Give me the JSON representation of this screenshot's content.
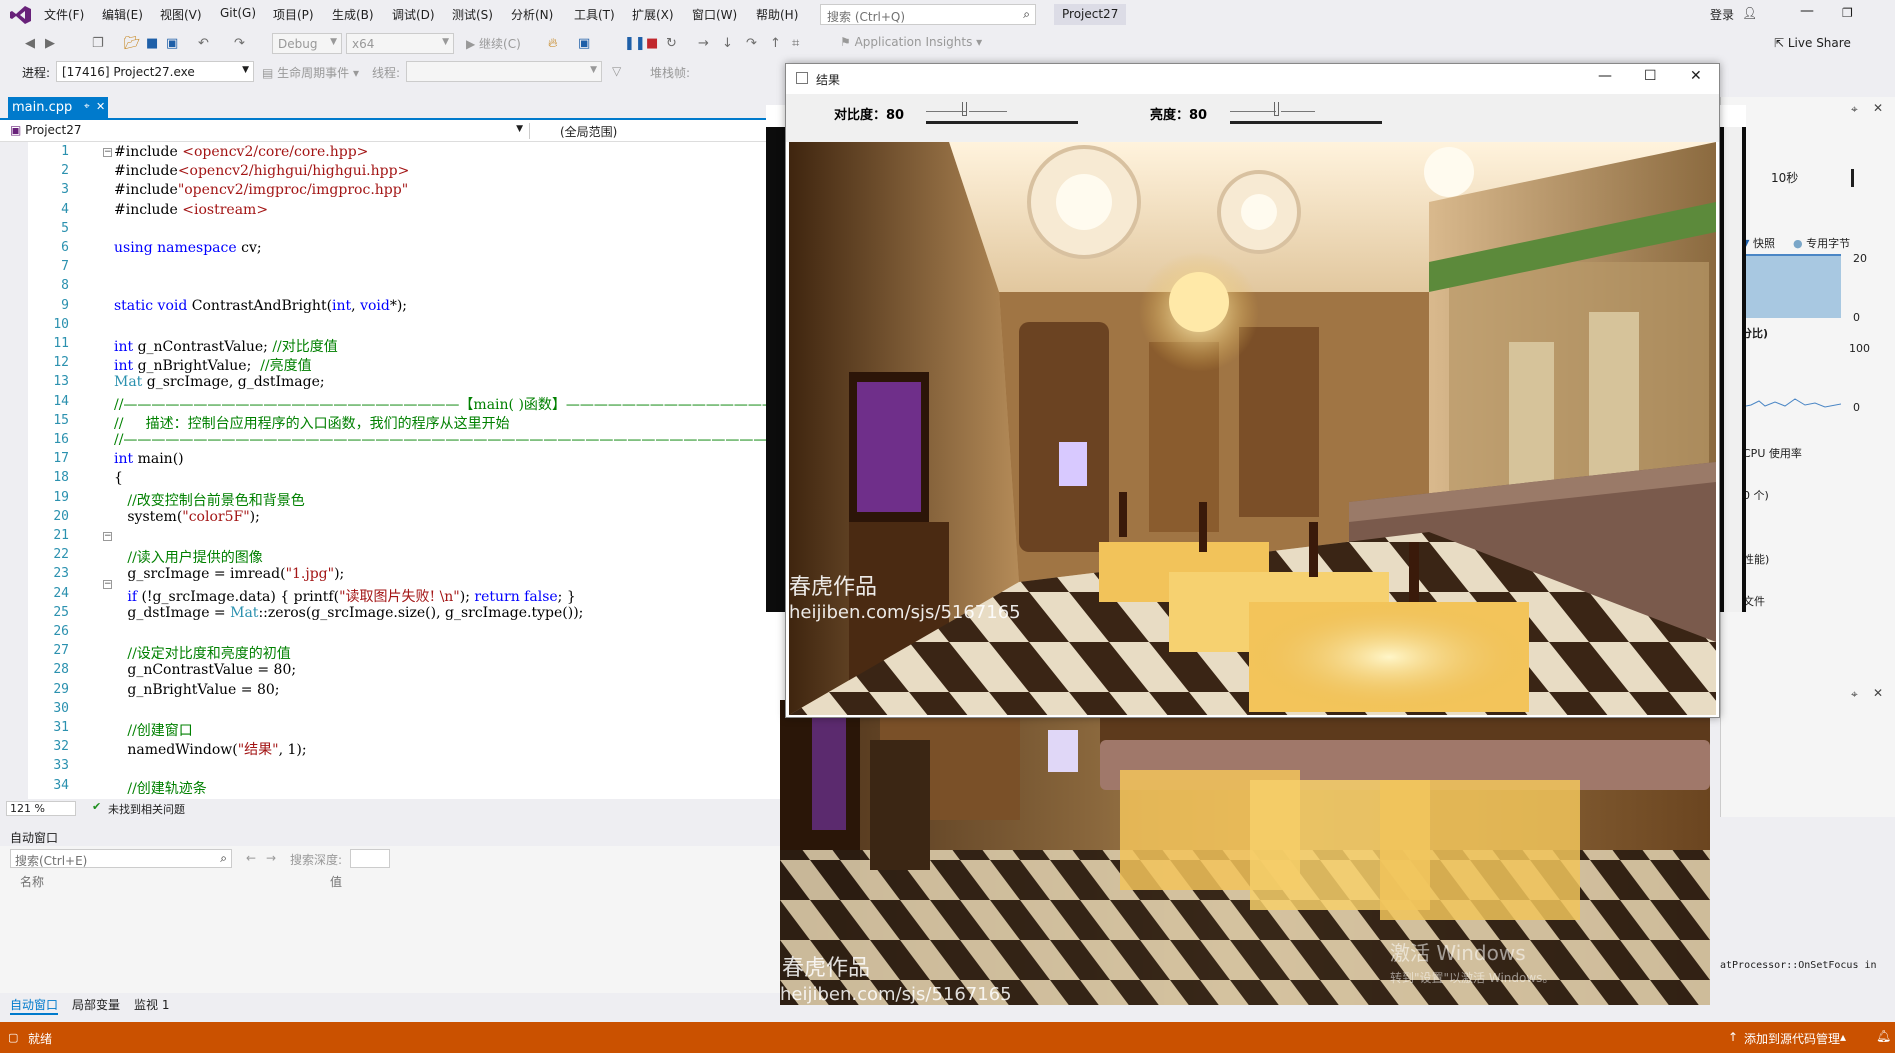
{
  "menubar": {
    "items": [
      "文件(F)",
      "编辑(E)",
      "视图(V)",
      "Git(G)",
      "项目(P)",
      "生成(B)",
      "调试(D)",
      "测试(S)",
      "分析(N)",
      "工具(T)",
      "扩展(X)",
      "窗口(W)",
      "帮助(H)"
    ],
    "search_placeholder": "搜索 (Ctrl+Q)",
    "project_title": "Project27",
    "login": "登录",
    "live_share": "Live Share"
  },
  "toolbar": {
    "config": "Debug",
    "platform": "x64",
    "continue": "继续(C)",
    "insights": "Application Insights"
  },
  "debugbar": {
    "process_label": "进程:",
    "process_value": "[17416] Project27.exe",
    "lifecycle": "生命周期事件",
    "thread_label": "线程:",
    "stackframe": "堆栈帧:"
  },
  "editor": {
    "tab_name": "main.cpp",
    "nav_project": "Project27",
    "nav_scope": "(全局范围)",
    "zoom": "121 %",
    "issues": "未找到相关问题",
    "lines": [
      {
        "n": "1",
        "parts": [
          [
            "",
            "#include "
          ],
          [
            "str",
            "<opencv2/core/core.hpp>"
          ]
        ]
      },
      {
        "n": "2",
        "parts": [
          [
            "",
            "#include"
          ],
          [
            "str",
            "<opencv2/highgui/highgui.hpp>"
          ]
        ]
      },
      {
        "n": "3",
        "parts": [
          [
            "",
            "#include"
          ],
          [
            "str",
            "\"opencv2/imgproc/imgproc.hpp\""
          ]
        ]
      },
      {
        "n": "4",
        "parts": [
          [
            "",
            "#include "
          ],
          [
            "str",
            "<iostream>"
          ]
        ]
      },
      {
        "n": "5",
        "parts": []
      },
      {
        "n": "6",
        "parts": [
          [
            "kw",
            "using namespace "
          ],
          [
            "",
            "cv;"
          ]
        ]
      },
      {
        "n": "7",
        "parts": []
      },
      {
        "n": "8",
        "parts": []
      },
      {
        "n": "9",
        "parts": [
          [
            "kw",
            "static void "
          ],
          [
            "",
            "ContrastAndBright("
          ],
          [
            "kw",
            "int"
          ],
          [
            "",
            ", "
          ],
          [
            "kw",
            "void"
          ],
          [
            "",
            "*);"
          ]
        ]
      },
      {
        "n": "10",
        "parts": []
      },
      {
        "n": "11",
        "parts": [
          [
            "kw",
            "int "
          ],
          [
            "",
            "g_nContrastValue; "
          ],
          [
            "cm",
            "//对比度值"
          ]
        ]
      },
      {
        "n": "12",
        "parts": [
          [
            "kw",
            "int "
          ],
          [
            "",
            "g_nBrightValue;  "
          ],
          [
            "cm",
            "//亮度值"
          ]
        ]
      },
      {
        "n": "13",
        "parts": [
          [
            "ty",
            "Mat "
          ],
          [
            "",
            "g_srcImage, g_dstImage;"
          ]
        ]
      },
      {
        "n": "14",
        "parts": [
          [
            "cm",
            "//————————————————————————【main( )函数】——————————————————————————"
          ]
        ]
      },
      {
        "n": "15",
        "parts": [
          [
            "cm",
            "//     描述：控制台应用程序的入口函数，我们的程序从这里开始"
          ]
        ]
      },
      {
        "n": "16",
        "parts": [
          [
            "cm",
            "//———————————————————————————————————————————————————————————————"
          ]
        ]
      },
      {
        "n": "17",
        "parts": [
          [
            "kw",
            "int "
          ],
          [
            "",
            "main()"
          ]
        ]
      },
      {
        "n": "18",
        "parts": [
          [
            "",
            "{"
          ]
        ]
      },
      {
        "n": "19",
        "parts": [
          [
            "cm",
            "   //改变控制台前景色和背景色"
          ]
        ]
      },
      {
        "n": "20",
        "parts": [
          [
            "",
            "   system("
          ],
          [
            "str",
            "\"color5F\""
          ],
          [
            "",
            ");"
          ]
        ]
      },
      {
        "n": "21",
        "parts": []
      },
      {
        "n": "22",
        "parts": [
          [
            "cm",
            "   //读入用户提供的图像"
          ]
        ]
      },
      {
        "n": "23",
        "parts": [
          [
            "",
            "   g_srcImage = imread("
          ],
          [
            "str",
            "\"1.jpg\""
          ],
          [
            "",
            ");"
          ]
        ]
      },
      {
        "n": "24",
        "parts": [
          [
            "kw",
            "   if "
          ],
          [
            "",
            "(!g_srcImage.data) { printf("
          ],
          [
            "str",
            "\"读取图片失败! \\n\""
          ],
          [
            "",
            "); "
          ],
          [
            "kw",
            "return false"
          ],
          [
            "",
            "; }"
          ]
        ]
      },
      {
        "n": "25",
        "parts": [
          [
            "",
            "   g_dstImage = "
          ],
          [
            "ty",
            "Mat"
          ],
          [
            "",
            "::zeros(g_srcImage.size(), g_srcImage.type());"
          ]
        ]
      },
      {
        "n": "26",
        "parts": []
      },
      {
        "n": "27",
        "parts": [
          [
            "cm",
            "   //设定对比度和亮度的初值"
          ]
        ]
      },
      {
        "n": "28",
        "parts": [
          [
            "",
            "   g_nContrastValue = 80;"
          ]
        ]
      },
      {
        "n": "29",
        "parts": [
          [
            "",
            "   g_nBrightValue = 80;"
          ]
        ]
      },
      {
        "n": "30",
        "parts": []
      },
      {
        "n": "31",
        "parts": [
          [
            "cm",
            "   //创建窗口"
          ]
        ]
      },
      {
        "n": "32",
        "parts": [
          [
            "",
            "   namedWindow("
          ],
          [
            "str",
            "\"结果\""
          ],
          [
            "",
            ", 1);"
          ]
        ]
      },
      {
        "n": "33",
        "parts": []
      },
      {
        "n": "34",
        "parts": [
          [
            "cm",
            "   //创建轨迹条"
          ]
        ]
      }
    ]
  },
  "autowin": {
    "title": "自动窗口",
    "search_placeholder": "搜索(Ctrl+E)",
    "depth_label": "搜索深度:",
    "col_name": "名称",
    "col_value": "值",
    "tabs": [
      "自动窗口",
      "局部变量",
      "监视 1"
    ]
  },
  "diag": {
    "time": "10秒",
    "snapshot": "快照",
    "private_bytes": "专用字节",
    "v20": "20",
    "v0a": "0",
    "percent": "分比)",
    "v100": "100",
    "v0b": "0",
    "cpu_usage": "CPU 使用率",
    "count": "0 个)",
    "perf": "性能)",
    "file": "文件"
  },
  "result_window": {
    "title": "结果",
    "contrast_label": "对比度：80",
    "bright_label": "亮度：80",
    "contrast_value": 80,
    "bright_value": 80,
    "watermark_1": "春虎作品",
    "watermark_2": "heijiben.com/sjs/5167165"
  },
  "second_window": {
    "watermark_1": "春虎作品",
    "watermark_2": "heijiben.com/sjs/5167165",
    "activate_windows": "激活 Windows",
    "activate_windows_sub": "转到\"设置\"以激活 Windows。",
    "tooltip": "atProcessor::OnSetFocus in"
  },
  "statusbar": {
    "ready": "就绪",
    "add_source": "添加到源代码管理"
  },
  "colors": {
    "accent": "#007acc",
    "status": "#ca5100"
  }
}
